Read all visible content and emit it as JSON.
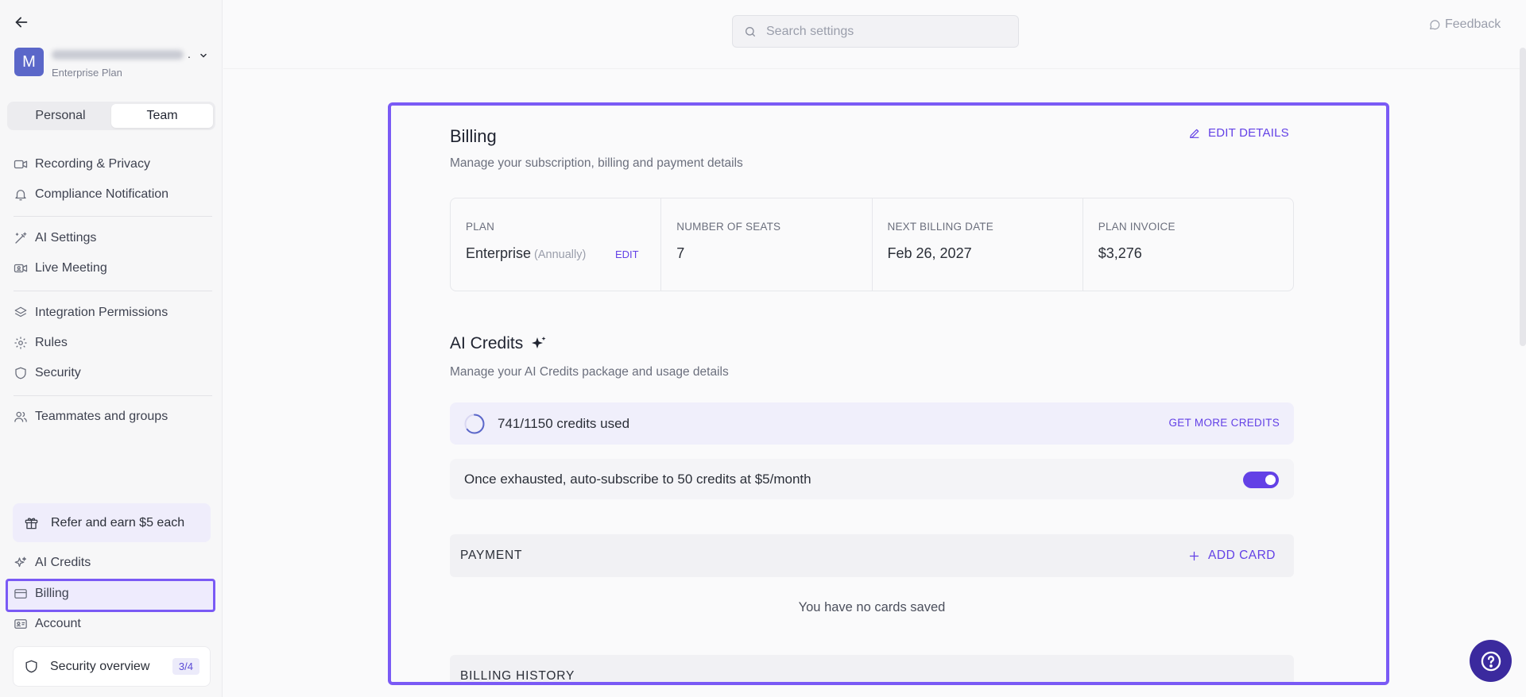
{
  "account": {
    "avatar_letter": "M",
    "plan": "Enterprise Plan",
    "name_suffix": "."
  },
  "segment": {
    "personal": "Personal",
    "team": "Team",
    "selected": "Team"
  },
  "sidebar": {
    "items": [
      {
        "label": "Recording & Privacy",
        "icon": "video-camera-icon"
      },
      {
        "label": "Compliance Notification",
        "icon": "bell-icon"
      },
      {
        "label": "AI Settings",
        "icon": "magic-wand-icon"
      },
      {
        "label": "Live Meeting",
        "icon": "video-meeting-icon"
      },
      {
        "label": "Integration Permissions",
        "icon": "layers-icon"
      },
      {
        "label": "Rules",
        "icon": "gear-icon"
      },
      {
        "label": "Security",
        "icon": "shield-icon"
      },
      {
        "label": "Teammates and groups",
        "icon": "users-icon"
      }
    ],
    "refer": "Refer and earn $5 each",
    "bottom_items": [
      {
        "label": "AI Credits",
        "icon": "sparkles-icon"
      },
      {
        "label": "Billing",
        "icon": "credit-card-icon",
        "active": true
      },
      {
        "label": "Account",
        "icon": "id-card-icon"
      }
    ],
    "security_overview": {
      "label": "Security overview",
      "badge": "3/4"
    }
  },
  "topbar": {
    "search_placeholder": "Search settings",
    "feedback": "Feedback"
  },
  "billing": {
    "title": "Billing",
    "subtitle": "Manage your subscription, billing and payment details",
    "edit_details": "EDIT DETAILS",
    "plan": {
      "plan_label": "PLAN",
      "plan_value": "Enterprise",
      "plan_period": "(Annually)",
      "plan_edit": "EDIT",
      "seats_label": "NUMBER OF SEATS",
      "seats_value": "7",
      "next_label": "NEXT BILLING DATE",
      "next_value": "Feb 26, 2027",
      "invoice_label": "PLAN INVOICE",
      "invoice_value": "$3,276"
    }
  },
  "ai_credits": {
    "title": "AI Credits",
    "subtitle": "Manage your AI Credits package and usage details",
    "used": 741,
    "total": 1150,
    "usage_text": "741/1150 credits used",
    "get_more": "GET MORE CREDITS",
    "auto_subscribe": "Once exhausted, auto-subscribe to 50 credits at $5/month",
    "auto_subscribe_enabled": true
  },
  "payment": {
    "title": "PAYMENT",
    "add_card": "ADD CARD",
    "empty": "You have no cards saved"
  },
  "billing_history": {
    "title": "BILLING HISTORY"
  },
  "colors": {
    "accent": "#6341e6",
    "highlight": "#7a5af5",
    "help_button": "#3b2a9e"
  }
}
